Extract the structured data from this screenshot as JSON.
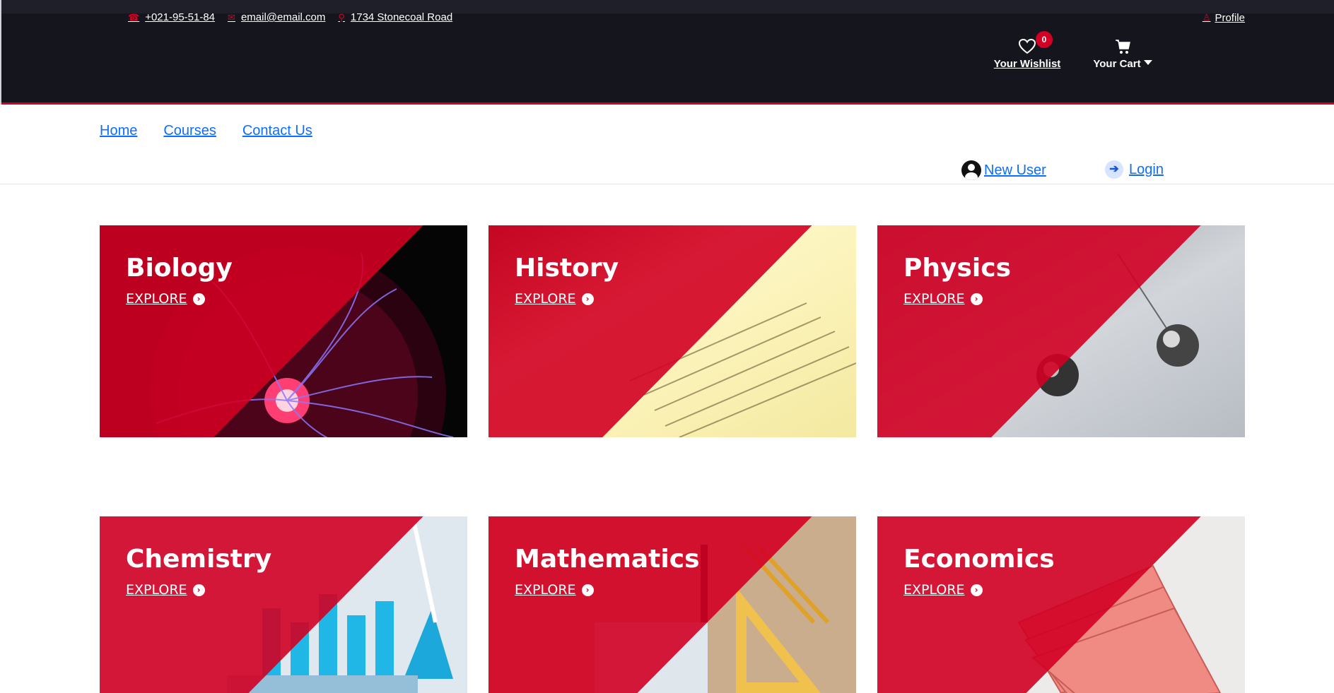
{
  "topbar": {
    "phone": "+021-95-51-84",
    "email": "email@email.com",
    "address": "1734 Stonecoal Road",
    "profile": "Profile"
  },
  "header": {
    "wishlist_label": "Your Wishlist",
    "wishlist_count": "0",
    "cart_label": "Your Cart"
  },
  "nav": {
    "home": "Home",
    "courses": "Courses",
    "contact": "Contact Us",
    "new_user": "New User",
    "login": "Login"
  },
  "courses": [
    {
      "name": "Biology",
      "cta": "EXPLORE"
    },
    {
      "name": "History",
      "cta": "EXPLORE"
    },
    {
      "name": "Physics",
      "cta": "EXPLORE"
    },
    {
      "name": "Chemistry",
      "cta": "EXPLORE"
    },
    {
      "name": "Mathematics",
      "cta": "EXPLORE"
    },
    {
      "name": "Economics",
      "cta": "EXPLORE"
    }
  ],
  "colors": {
    "header_bg": "#15161d",
    "accent": "#d10024",
    "link": "#0d6efd"
  },
  "icons": {
    "phone": "phone-icon",
    "email": "envelope-icon",
    "address": "map-marker-icon",
    "profile": "user-icon",
    "wishlist": "heart-icon",
    "cart": "shopping-cart-icon",
    "new_user": "user-circle-icon",
    "login": "sign-in-icon",
    "explore": "arrow-circle-right-icon"
  }
}
